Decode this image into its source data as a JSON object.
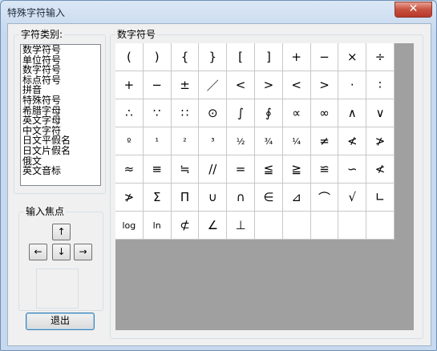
{
  "window": {
    "title": "特殊字符输入",
    "close_glyph": "✕"
  },
  "category_group": {
    "label": "字符类别:",
    "items": [
      "数学符号",
      "单位符号",
      "数字符号",
      "标点符号",
      "拼音",
      "特殊符号",
      "希腊字母",
      "英文字母",
      "中文字符",
      "日文平假名",
      "日文片假名",
      "俄文",
      "英文音标"
    ]
  },
  "focus_group": {
    "label": "输入焦点",
    "up": "↑",
    "left": "←",
    "down": "↓",
    "right": "→"
  },
  "exit_label": "退出",
  "symbols_group": {
    "label": "数字符号",
    "cells": [
      "(",
      ")",
      "{",
      "}",
      "[",
      "]",
      "+",
      "−",
      "×",
      "÷",
      "+",
      "−",
      "±",
      "／",
      "<",
      ">",
      "<",
      ">",
      "·",
      "∶",
      "∴",
      "∵",
      "∷",
      "⊙",
      "∫",
      "∮",
      "∝",
      "∞",
      "∧",
      "∨",
      "º",
      "¹",
      "²",
      "³",
      "½",
      "¾",
      "¼",
      "≠",
      "≮",
      "≯",
      "≈",
      "≡",
      "≒",
      "//",
      "=",
      "≦",
      "≧",
      "≌",
      "∽",
      "≮",
      "≯",
      "Σ",
      "Π",
      "∪",
      "∩",
      "∈",
      "⊿",
      "⌒",
      "√",
      "∟",
      "log",
      "ln",
      "⊄",
      "∠",
      "⊥",
      "",
      "",
      "",
      "",
      ""
    ]
  }
}
